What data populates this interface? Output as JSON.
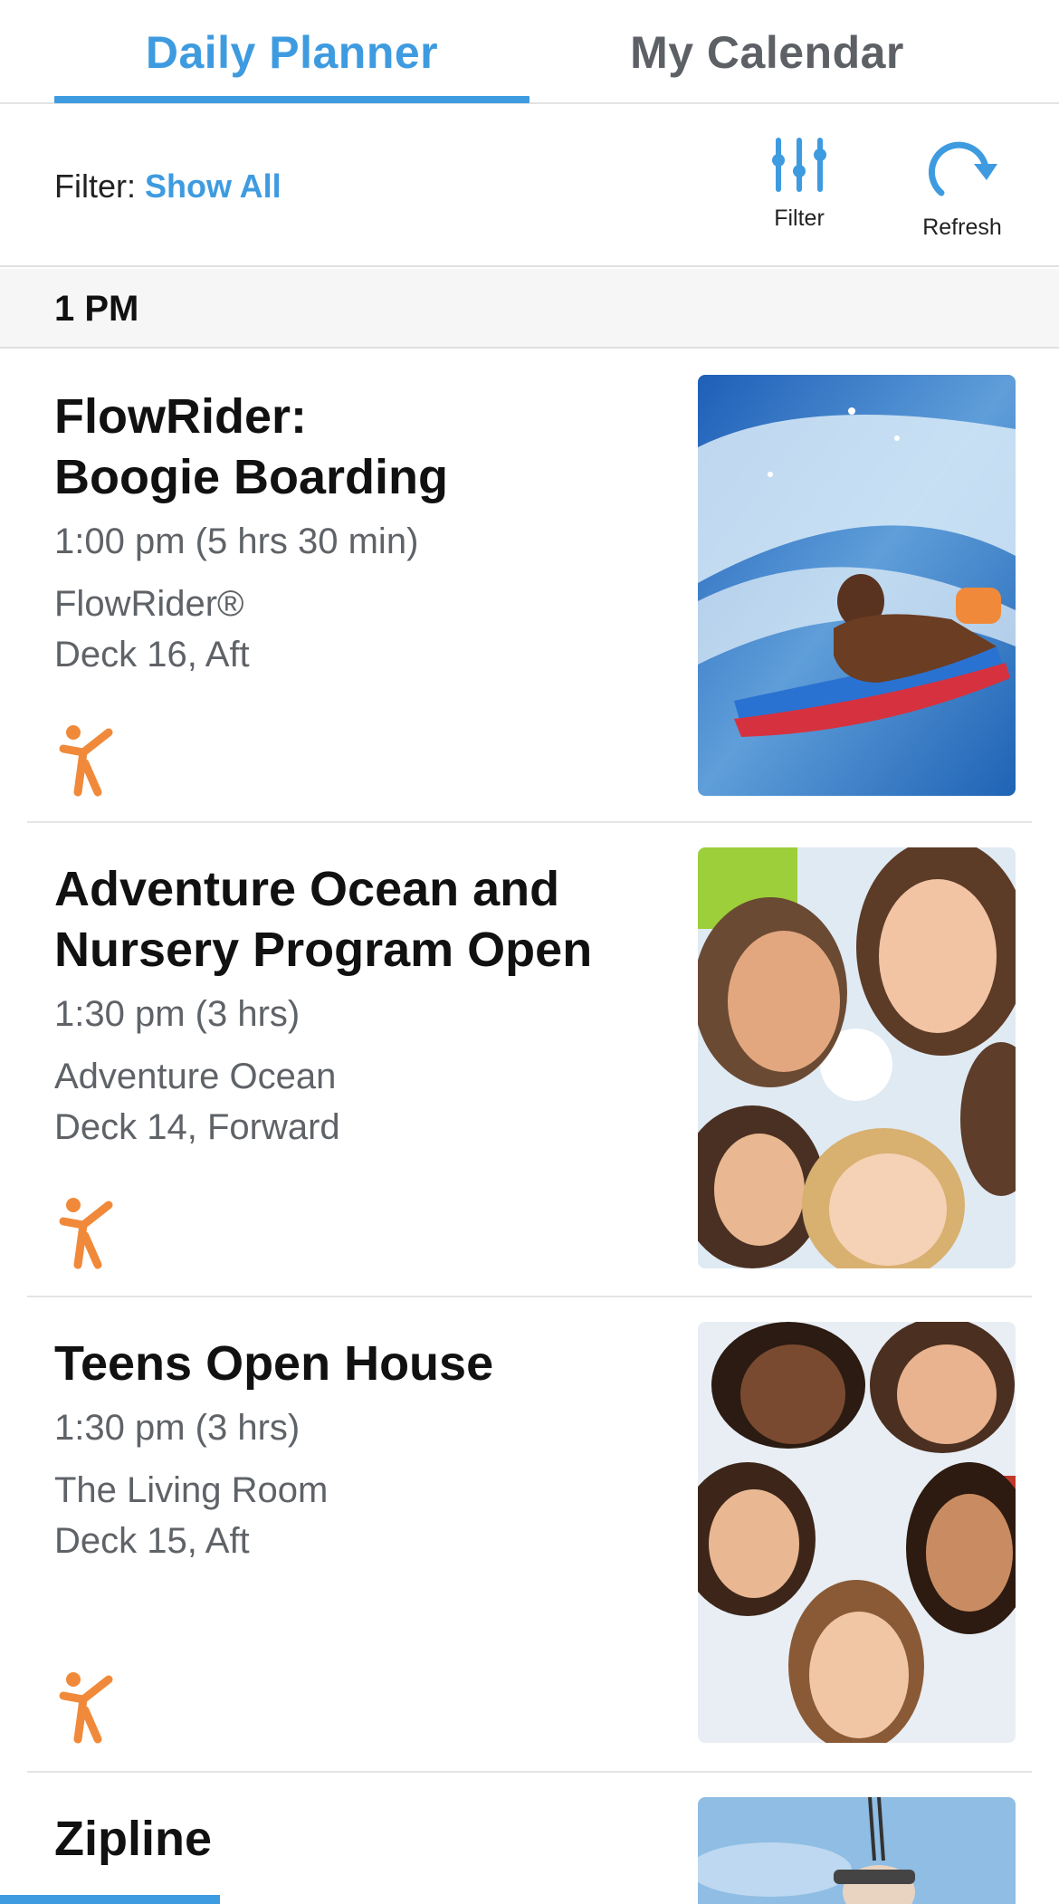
{
  "tabs": [
    {
      "label": "Daily Planner",
      "active": true
    },
    {
      "label": "My Calendar",
      "active": false
    }
  ],
  "filter": {
    "prefix": "Filter:",
    "value": "Show All",
    "filter_button_label": "Filter",
    "refresh_button_label": "Refresh"
  },
  "time_header": "1 PM",
  "activities": [
    {
      "title_line1": "FlowRider:",
      "title_line2": "Boogie Boarding",
      "time": "1:00 pm (5 hrs 30 min)",
      "venue": "FlowRider®",
      "deck": "Deck 16, Aft",
      "icon": "active-person-icon",
      "image": "child-boogie-boarding-photo"
    },
    {
      "title_line1": "Adventure Ocean and",
      "title_line2": "Nursery Program Open",
      "time": "1:30 pm (3 hrs)",
      "venue": "Adventure Ocean",
      "deck": "Deck 14, Forward",
      "icon": "active-person-icon",
      "image": "kids-circle-photo"
    },
    {
      "title_line1": "Teens Open House",
      "time": "1:30 pm (3 hrs)",
      "venue": "The Living Room",
      "deck": "Deck 15, Aft",
      "icon": "active-person-icon",
      "image": "teens-circle-photo"
    },
    {
      "title_line1": "Zipline",
      "image": "zipline-photo"
    }
  ],
  "colors": {
    "accent": "#3e9be0",
    "activity_icon": "#f08a3a",
    "text_secondary": "#5f6368"
  }
}
